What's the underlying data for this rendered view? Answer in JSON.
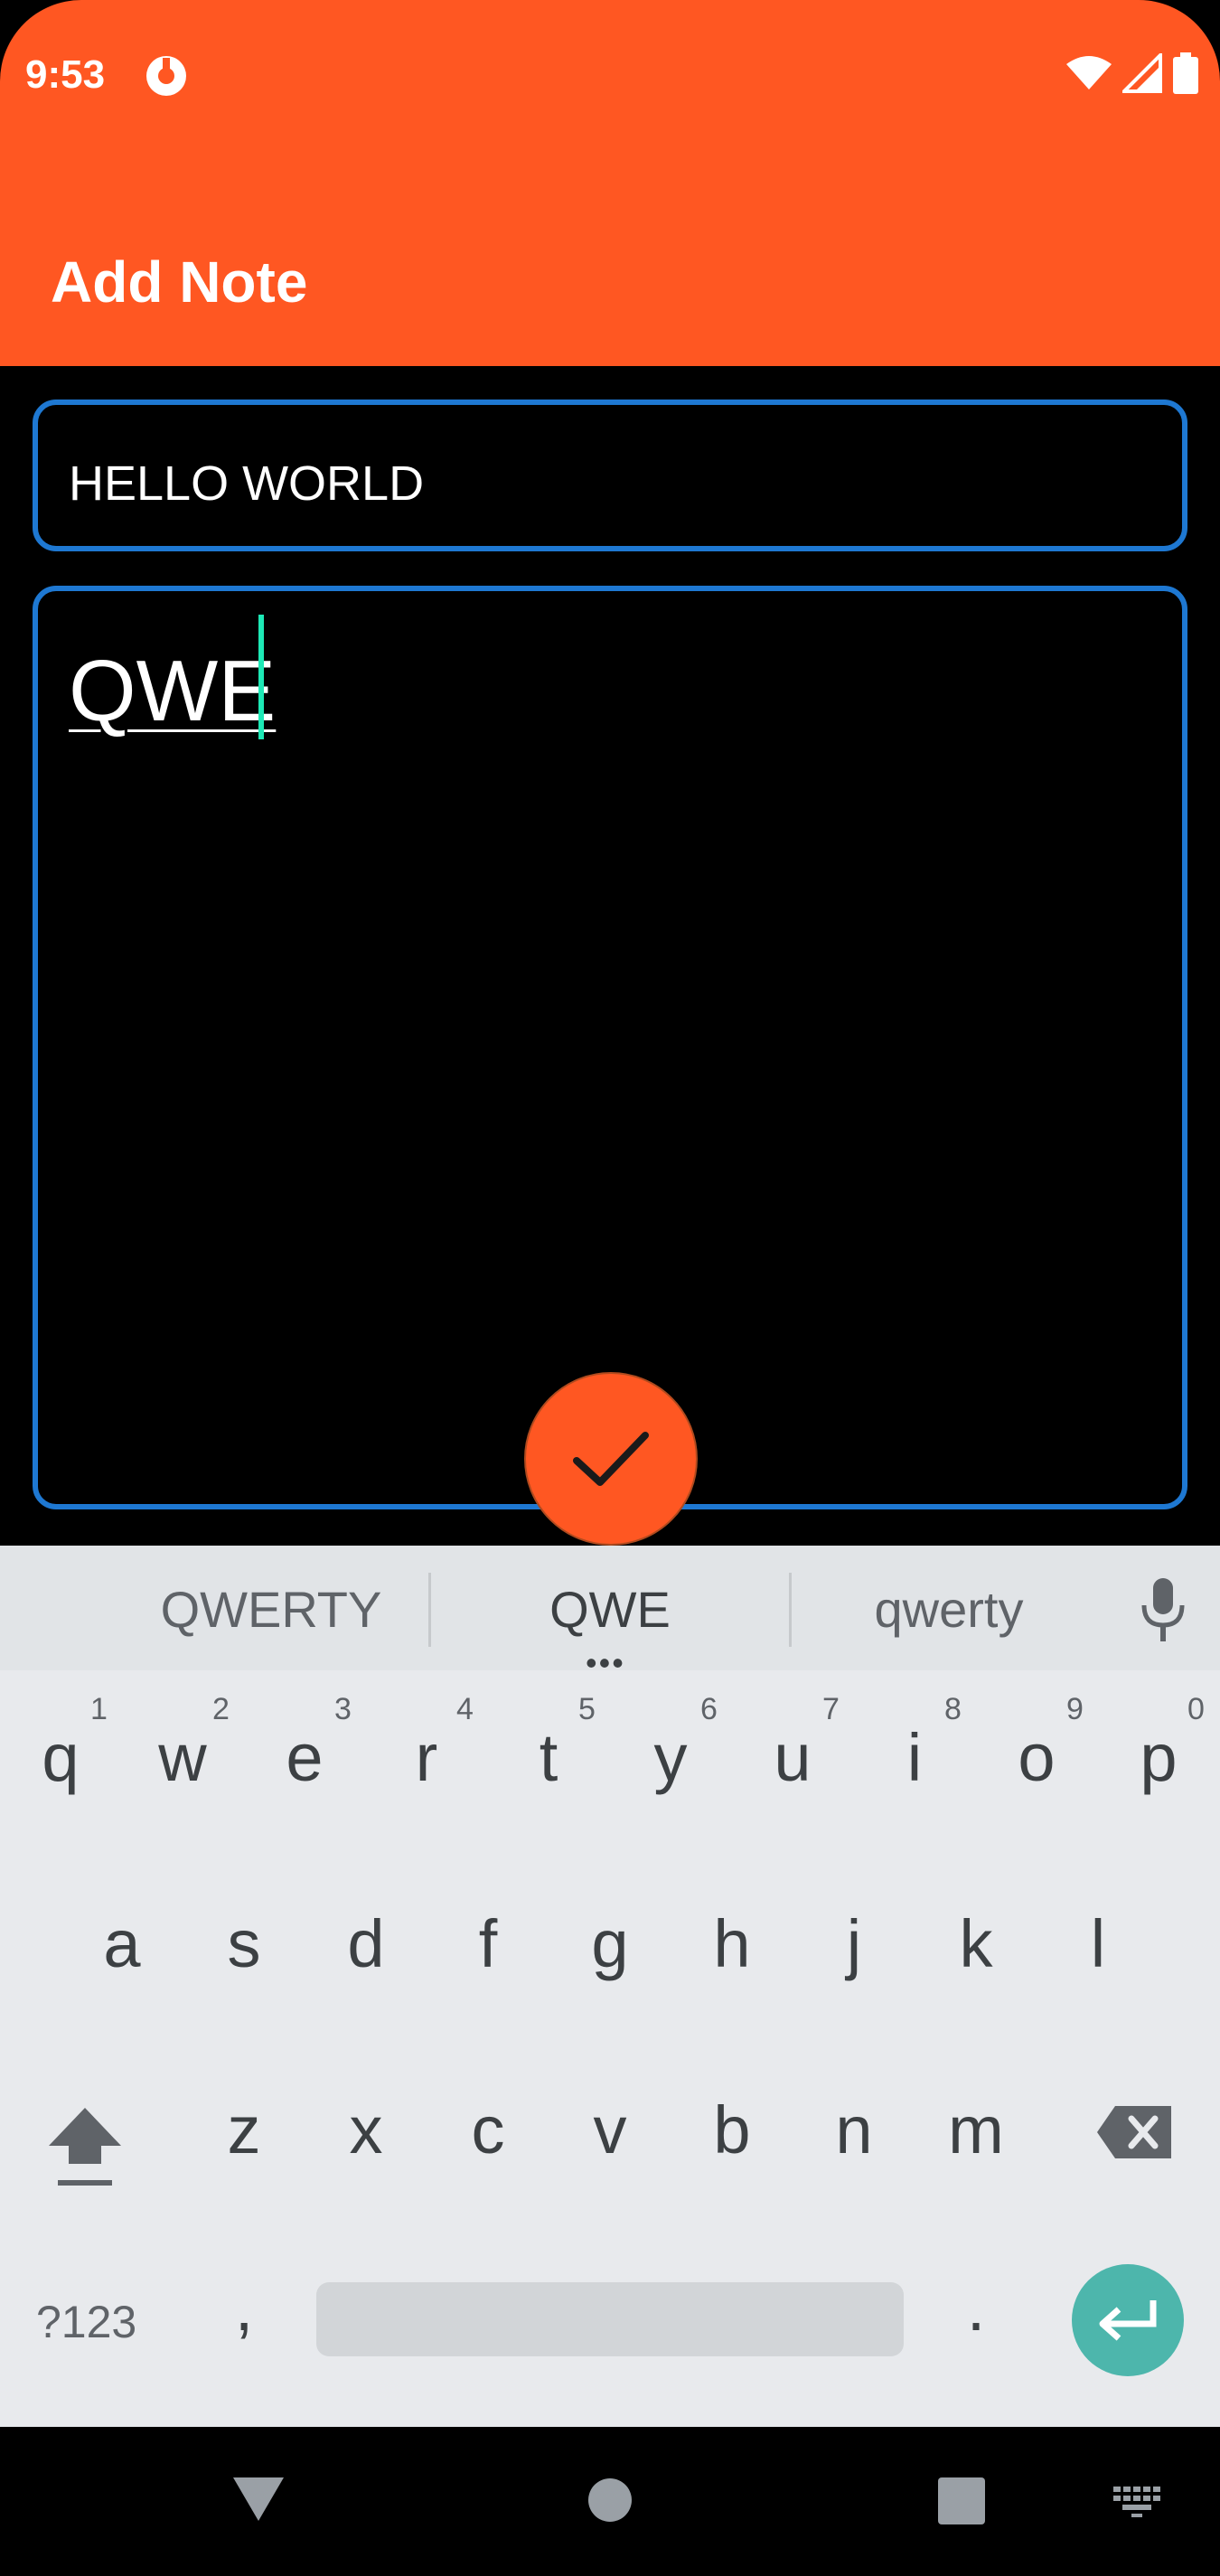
{
  "status_bar": {
    "time": "9:53"
  },
  "app_bar": {
    "title": "Add Note"
  },
  "form": {
    "title_value": "HELLO WORLD",
    "note_value": "QWE"
  },
  "keyboard": {
    "suggestions": [
      "QWERTY",
      "QWE",
      "qwerty"
    ],
    "row1": [
      "q",
      "w",
      "e",
      "r",
      "t",
      "y",
      "u",
      "i",
      "o",
      "p"
    ],
    "row1_nums": [
      "1",
      "2",
      "3",
      "4",
      "5",
      "6",
      "7",
      "8",
      "9",
      "0"
    ],
    "row2": [
      "a",
      "s",
      "d",
      "f",
      "g",
      "h",
      "j",
      "k",
      "l"
    ],
    "row3": [
      "z",
      "x",
      "c",
      "v",
      "b",
      "n",
      "m"
    ],
    "symbols_key": "?123",
    "comma": ",",
    "period": "."
  },
  "colors": {
    "accent": "#FF5722",
    "field_border": "#1E78D2",
    "cursor": "#1DE9B6",
    "enter_key": "#4DB6AC"
  },
  "icons": [
    "app-notification-icon",
    "wifi-icon",
    "signal-icon",
    "battery-icon",
    "check-icon",
    "mic-icon",
    "shift-icon",
    "backspace-icon",
    "enter-icon",
    "back-icon",
    "home-icon",
    "recents-icon",
    "keyboard-switch-icon"
  ]
}
